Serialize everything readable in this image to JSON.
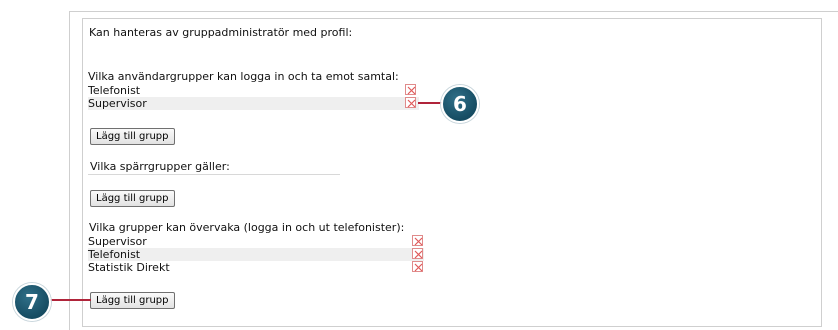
{
  "profile_heading": "Kan hanteras av gruppadministratör med profil:",
  "login_groups": {
    "label": "Vilka användargrupper kan logga in och ta emot samtal:",
    "items": [
      "Telefonist",
      "Supervisor"
    ],
    "add_button": "Lägg till grupp"
  },
  "block_groups": {
    "label": "Vilka spärrgrupper gäller:",
    "add_button": "Lägg till grupp"
  },
  "monitor_groups": {
    "label": "Vilka grupper kan övervaka (logga in och ut telefonister):",
    "items": [
      "Supervisor",
      "Telefonist",
      "Statistik Direkt"
    ],
    "add_button": "Lägg till grupp"
  },
  "callouts": [
    "6",
    "7"
  ],
  "colors": {
    "callout": "#1b5268",
    "leader": "#b0243a",
    "remove_icon": "#e05a5a"
  }
}
